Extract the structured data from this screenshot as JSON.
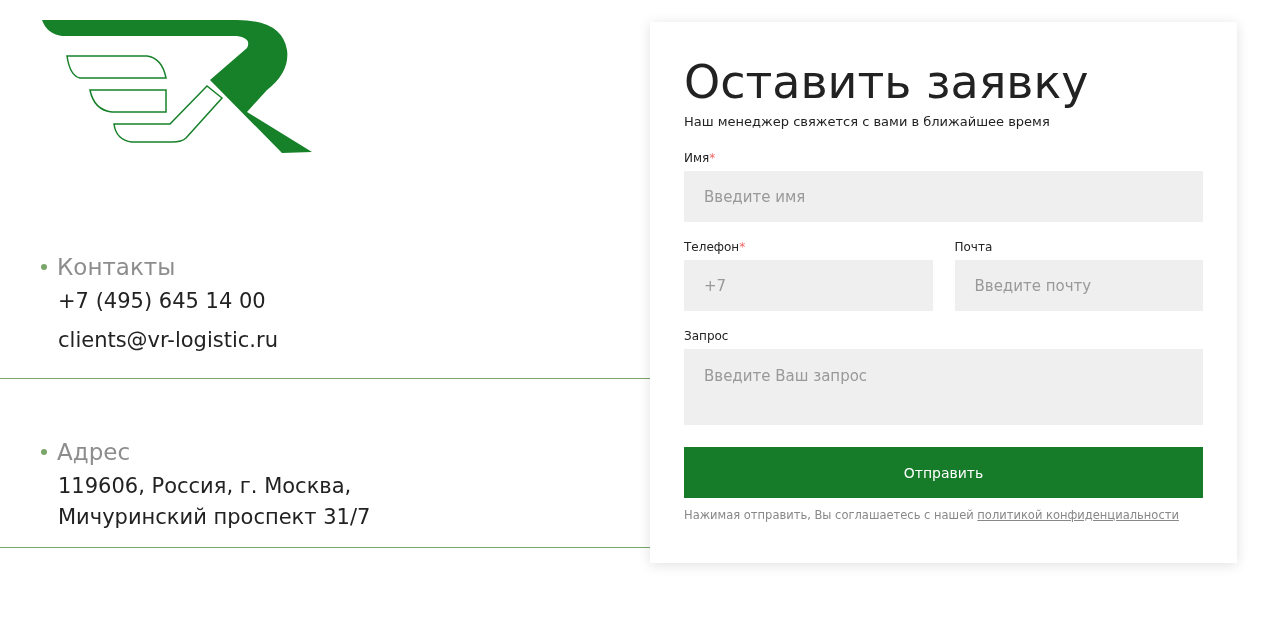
{
  "contacts": [
    {
      "heading": "Контакты",
      "lines": [
        "+7 (495) 645 14 00",
        "clients@vr-logistic.ru"
      ]
    },
    {
      "heading": "Адрес",
      "lines": [
        "119606, Россия, г. Москва,",
        "Мичуринский проспект 31/7"
      ]
    }
  ],
  "form": {
    "title": "Оставить заявку",
    "subtitle": "Наш менеджер свяжется с вами в ближайшее время",
    "rows": [
      [
        {
          "kind": "text",
          "label": "Имя",
          "required_mark": "*",
          "placeholder": "Введите имя"
        }
      ],
      [
        {
          "kind": "text",
          "label": "Телефон",
          "required_mark": "*",
          "placeholder": "+7"
        },
        {
          "kind": "text",
          "label": "Почта",
          "placeholder": "Введите почту"
        }
      ],
      [
        {
          "kind": "textarea",
          "label": "Запрос",
          "placeholder": "Введите Ваш запрос"
        }
      ]
    ],
    "submit": "Отправить",
    "consent": "Нажимая отправить, Вы соглашаетесь с нашей",
    "consent_link": "политикой конфиденциальности"
  }
}
